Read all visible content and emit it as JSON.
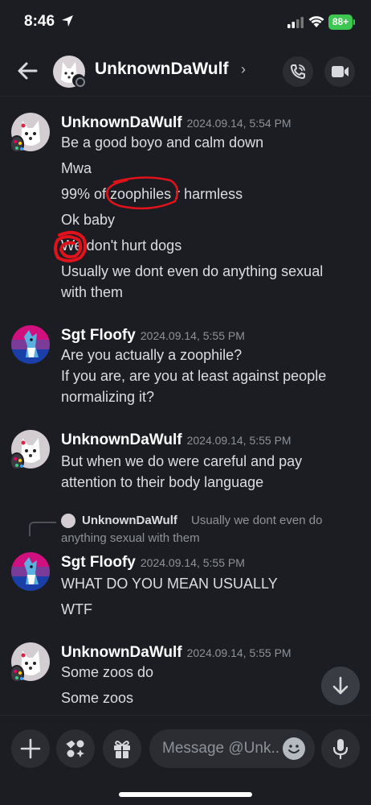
{
  "status_bar": {
    "time": "8:46",
    "battery": "88+"
  },
  "header": {
    "name": "UnknownDaWulf",
    "chevron": "›"
  },
  "messages": [
    {
      "author": "UnknownDaWulf",
      "timestamp": "2024.09.14, 5:54 PM",
      "lines": [
        "Be a good boyo and calm down",
        "Mwa",
        "99% of zoophiles r harmless",
        "Ok baby",
        "We don't hurt dogs",
        "Usually we dont even do anything sexual with them"
      ]
    },
    {
      "author": "Sgt Floofy",
      "timestamp": "2024.09.14, 5:55 PM",
      "lines": [
        "Are you actually a zoophile?\nIf you are, are you at least against people normalizing it?"
      ]
    },
    {
      "author": "UnknownDaWulf",
      "timestamp": "2024.09.14, 5:55 PM",
      "lines": [
        "But when we do were careful and pay attention to their body language"
      ]
    },
    {
      "reply": {
        "author": "UnknownDaWulf",
        "text": "Usually we dont even do anything sexual with them"
      },
      "author": "Sgt Floofy",
      "timestamp": "2024.09.14, 5:55 PM",
      "lines": [
        "WHAT DO YOU MEAN USUALLY",
        "WTF"
      ]
    },
    {
      "author": "UnknownDaWulf",
      "timestamp": "2024.09.14, 5:55 PM",
      "lines": [
        "Some zoos do",
        "Some zoos"
      ]
    }
  ],
  "composer": {
    "placeholder": "Message @Unk..."
  },
  "icons": {
    "back": "arrow-left-icon",
    "call": "phone-icon",
    "video": "video-camera-icon",
    "add": "plus-icon",
    "apps": "apps-icon",
    "gift": "gift-icon",
    "emoji": "emoji-icon",
    "mic": "microphone-icon",
    "scroll": "arrow-down-icon"
  },
  "colors": {
    "background": "#1c1d22",
    "annotation": "#e0121b",
    "battery": "#3ec653"
  }
}
